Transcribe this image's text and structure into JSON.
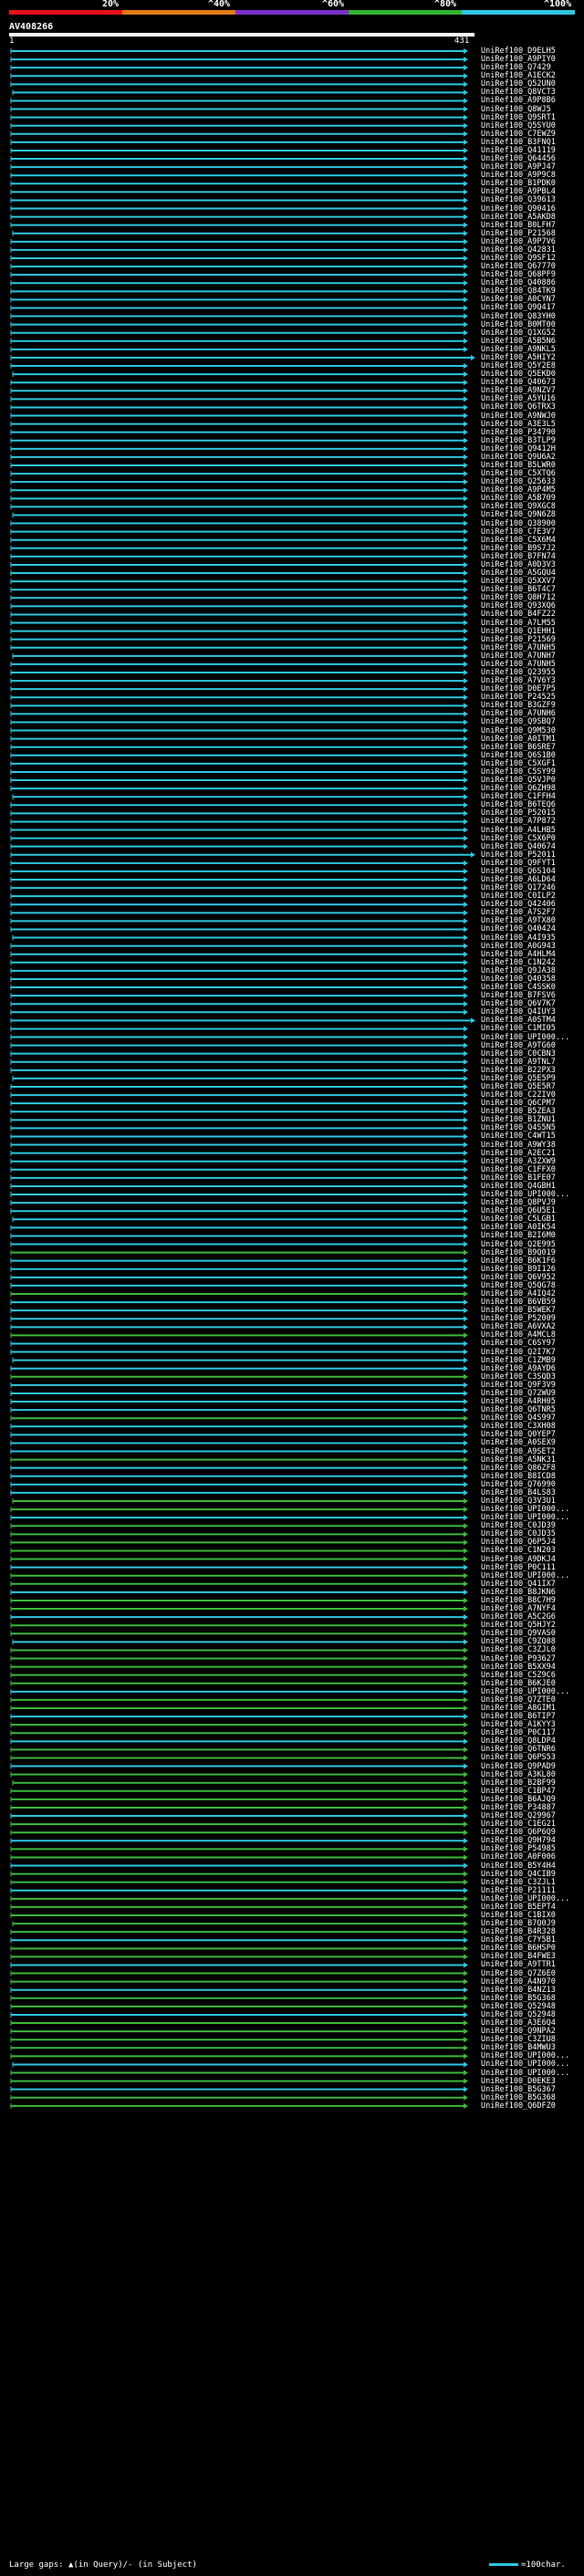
{
  "scale": {
    "labels": [
      "20%",
      "^40%",
      "^60%",
      "^80%",
      "^100%"
    ],
    "colors": [
      "#e8101a",
      "#e07a12",
      "#7b2fc9",
      "#2fb32f",
      "#2ec6e0"
    ]
  },
  "query": {
    "id": "AV408266",
    "start": "1",
    "end": "431"
  },
  "colors": {
    "cyan": "#2ec6e0",
    "green": "#3db83d",
    "white": "#ffffff",
    "background": "#000000"
  },
  "hits": [
    "UniRef100_D9ELH5",
    "UniRef100_A9PIY0",
    "UniRef100_Q7429",
    "UniRef100_A1ECK2",
    "UniRef100_Q52UN0",
    "UniRef100_Q8VCT3",
    "UniRef100_A9P8B6",
    "UniRef100_Q8WJ5",
    "UniRef100_Q9SRT1",
    "UniRef100_Q5SYU0",
    "UniRef100_C7EWZ9",
    "UniRef100_B3FNQ1",
    "UniRef100_Q41119",
    "UniRef100_Q64456",
    "UniRef100_A9PJ47",
    "UniRef100_A9P9C8",
    "UniRef100_B1PDK0",
    "UniRef100_A9PBL4",
    "UniRef100_Q39613",
    "UniRef100_Q90416",
    "UniRef100_A5AKD8",
    "UniRef100_B0LFH7",
    "UniRef100_P21568",
    "UniRef100_A9P7V6",
    "UniRef100_Q42831",
    "UniRef100_Q9SF12",
    "UniRef100_Q67770",
    "UniRef100_Q68PF9",
    "UniRef100_Q40886",
    "UniRef100_Q84TK9",
    "UniRef100_A0CYN7",
    "UniRef100_Q9Q417",
    "UniRef100_Q83YH0",
    "UniRef100_B0MT00",
    "UniRef100_Q1XG52",
    "UniRef100_A5B5N6",
    "UniRef100_A9NKL5",
    "UniRef100_A5HIY2",
    "UniRef100_Q5Y2E8",
    "UniRef100_Q5EKD0",
    "UniRef100_Q40673",
    "UniRef100_A9NZV7",
    "UniRef100_A5YU16",
    "UniRef100_Q6TRX3",
    "UniRef100_A9NWJ0",
    "UniRef100_A3E3L5",
    "UniRef100_P34790",
    "UniRef100_B3TLP9",
    "UniRef100_Q9412H",
    "UniRef100_Q9U6A2",
    "UniRef100_B5LWR0",
    "UniRef100_C5XTQ6",
    "UniRef100_Q25633",
    "UniRef100_A9P4M5",
    "UniRef100_A5B709",
    "UniRef100_Q9XGC8",
    "UniRef100_Q9N6Z8",
    "UniRef100_Q38900",
    "UniRef100_C7E3V7",
    "UniRef100_C5X6M4",
    "UniRef100_B9S7J2",
    "UniRef100_B7FN74",
    "UniRef100_A0D3V3",
    "UniRef100_A5GQU4",
    "UniRef100_Q5XXV7",
    "UniRef100_B6T4C7",
    "UniRef100_Q8H712",
    "UniRef100_Q93XQ6",
    "UniRef100_B4FZ22",
    "UniRef100_A7LM55",
    "UniRef100_Q1EHH1",
    "UniRef100_P21569",
    "UniRef100_A7UNH5",
    "UniRef100_A7UNH7",
    "UniRef100_A7UNH5",
    "UniRef100_Q23955",
    "UniRef100_A7V6Y3",
    "UniRef100_D0E7P5",
    "UniRef100_P24525",
    "UniRef100_B3GZF9",
    "UniRef100_A7UNH6",
    "UniRef100_Q9SBQ7",
    "UniRef100_Q9M530",
    "UniRef100_A0ITM1",
    "UniRef100_B6SRE7",
    "UniRef100_Q6S1B0",
    "UniRef100_C5XGF1",
    "UniRef100_C5SY99",
    "UniRef100_Q5VJP0",
    "UniRef100_Q6ZH98",
    "UniRef100_C1FFH4",
    "UniRef100_B6TEQ6",
    "UniRef100_P52015",
    "UniRef100_A7P872",
    "UniRef100_A4LHB5",
    "UniRef100_C5X6P0",
    "UniRef100_Q40674",
    "UniRef100_P52011",
    "UniRef100_Q9FYT1",
    "UniRef100_Q6S104",
    "UniRef100_A6LD64",
    "UniRef100_Q17246",
    "UniRef100_C0ILP2",
    "UniRef100_Q42406",
    "UniRef100_A7S2F7",
    "UniRef100_A9TX80",
    "UniRef100_Q40424",
    "UniRef100_A4I935",
    "UniRef100_A0G943",
    "UniRef100_A4HLM4",
    "UniRef100_C1N242",
    "UniRef100_Q9JA38",
    "UniRef100_Q40358",
    "UniRef100_C4SSK0",
    "UniRef100_B7FSV6",
    "UniRef100_Q6V7K7",
    "UniRef100_Q4IUY3",
    "UniRef100_A0STM4",
    "UniRef100_C1MI05",
    "UniRef100_UPI000...",
    "UniRef100_A9TG60",
    "UniRef100_C0CBN3",
    "UniRef100_A9TNL7",
    "UniRef100_B22PX3",
    "UniRef100_Q5E5P9",
    "UniRef100_Q5E5R7",
    "UniRef100_C2ZIV0",
    "UniRef100_Q6CPM7",
    "UniRef100_B5ZEA3",
    "UniRef100_B1ZNU1",
    "UniRef100_Q4S5N5",
    "UniRef100_C4WT15",
    "UniRef100_A9WY38",
    "UniRef100_A2EC21",
    "UniRef100_A3ZXW9",
    "UniRef100_C1FFX0",
    "UniRef100_B1FE07",
    "UniRef100_Q4GBH1",
    "UniRef100_UPI000...",
    "UniRef100_Q8PVJ9",
    "UniRef100_Q6U5E1",
    "UniRef100_C5LGB1",
    "UniRef100_A0IK54",
    "UniRef100_B2I6M0",
    "UniRef100_Q2E995",
    "UniRef100_B9Q019",
    "UniRef100_B6K1F6",
    "UniRef100_B9I126",
    "UniRef100_Q6V952",
    "UniRef100_Q5QG78",
    "UniRef100_A4IQ42",
    "UniRef100_B6VB59",
    "UniRef100_B5WEK7",
    "UniRef100_P52009",
    "UniRef100_A6VXA2",
    "UniRef100_A4MCL8",
    "UniRef100_C6SY97",
    "UniRef100_Q2I7K7",
    "UniRef100_C1ZMB9",
    "UniRef100_A9AYD6",
    "UniRef100_C3SQD3",
    "UniRef100_Q9F3V9",
    "UniRef100_Q72WU9",
    "UniRef100_A4RH05",
    "UniRef100_Q6TNR5",
    "UniRef100_Q4S997",
    "UniRef100_C3XH08",
    "UniRef100_Q0YEP7",
    "UniRef100_A0SEX9",
    "UniRef100_A9SET2",
    "UniRef100_A5NK31",
    "UniRef100_Q86ZF8",
    "UniRef100_B8ICD8",
    "UniRef100_Q76990",
    "UniRef100_B4LS83",
    "UniRef100_Q3V3U1",
    "UniRef100_UPI000...",
    "UniRef100_UPI000...",
    "UniRef100_C0JD39",
    "UniRef100_C0JD35",
    "UniRef100_Q6P5J4",
    "UniRef100_C1N203",
    "UniRef100_A9DKJ4",
    "UniRef100_P0C111",
    "UniRef100_UPI000...",
    "UniRef100_Q41IX7",
    "UniRef100_B8JKN6",
    "UniRef100_B8C7H9",
    "UniRef100_A7NYF4",
    "UniRef100_A5C2G6",
    "UniRef100_Q5HJY2",
    "UniRef100_Q9VAS0",
    "UniRef100_C9ZQ88",
    "UniRef100_C3ZJL0",
    "UniRef100_P93627",
    "UniRef100_B5XX94",
    "UniRef100_C5Z9C6",
    "UniRef100_B6KJE0",
    "UniRef100_UPI000...",
    "UniRef100_Q7ZTE0",
    "UniRef100_A8GIM1",
    "UniRef100_B6TIP7",
    "UniRef100_A1KYY3",
    "UniRef100_P0C117",
    "UniRef100_Q8LDP4",
    "UniRef100_Q6TNR6",
    "UniRef100_Q6PS53",
    "UniRef100_Q9PAD9",
    "UniRef100_A3KL80",
    "UniRef100_B2BF99",
    "UniRef100_C1BP47",
    "UniRef100_B6AJQ9",
    "UniRef100_P34887",
    "UniRef100_Q29967",
    "UniRef100_C1EG21",
    "UniRef100_Q6P6Q9",
    "UniRef100_Q9H794",
    "UniRef100_P54985",
    "UniRef100_A0F006",
    "UniRef100_B5Y4H4",
    "UniRef100_Q4CIB9",
    "UniRef100_C3ZJL1",
    "UniRef100_P21111",
    "UniRef100_UPI000...",
    "UniRef100_B5EPT4",
    "UniRef100_C1BIX0",
    "UniRef100_B7Q0J9",
    "UniRef100_B4R328",
    "UniRef100_C7Y5B1",
    "UniRef100_B6HSP0",
    "UniRef100_B4FWE3",
    "UniRef100_A9TTR1",
    "UniRef100_Q7Z6E0",
    "UniRef100_A4N970",
    "UniRef100_B4NZ13",
    "UniRef100_B5G368",
    "UniRef100_Q52948",
    "UniRef100_Q52948",
    "UniRef100_A3E6Q4",
    "UniRef100_Q9NPA2",
    "UniRef100_C3ZIU8",
    "UniRef100_B4MWU3",
    "UniRef100_UPI000...",
    "UniRef100_UPI000...",
    "UniRef100_UPI000...",
    "UniRef100_D0EKE3",
    "UniRef100_B5G367",
    "UniRef100_B5G368",
    "UniRef100_Q6DFZ0"
  ],
  "legend": {
    "left": "Large gaps: ▲(in Query)/- (in Subject)",
    "right": "=100char."
  }
}
